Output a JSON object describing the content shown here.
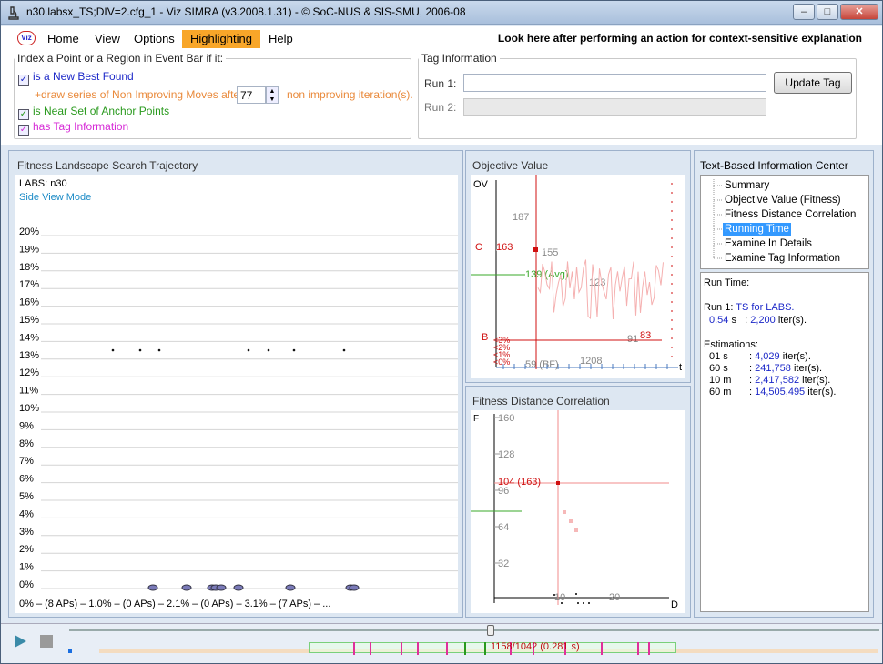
{
  "window": {
    "title": "n30.labsx_TS;DIV=2.cfg_1 - Viz SIMRA (v3.2008.1.31) - © SoC-NUS & SIS-SMU, 2006-08",
    "minimize": "–",
    "maximize": "□",
    "close": "✕"
  },
  "menu": {
    "logo": "Viz",
    "items": [
      "Home",
      "View",
      "Options",
      "Highlighting",
      "Help"
    ],
    "active": "Highlighting",
    "context_hint": "Look here after performing an action for context-sensitive explanation"
  },
  "index_group": {
    "legend": "Index a Point or a Region in Event Bar if it:",
    "opt1": "is a New Best Found",
    "opt1a_prefix": "+draw series of Non Improving Moves after:",
    "opt1a_value": "77",
    "opt1a_suffix": "non improving iteration(s).",
    "opt2": "is Near Set of Anchor Points",
    "opt3": "has Tag Information"
  },
  "tag_group": {
    "legend": "Tag Information",
    "run1_label": "Run 1:",
    "run2_label": "Run 2:",
    "run1_value": "",
    "run2_value": "",
    "update_button": "Update Tag"
  },
  "fitness_panel": {
    "title": "Fitness Landscape Search Trajectory",
    "instance": "LABS: n30",
    "mode": "Side View Mode",
    "y_ticks": [
      "20%",
      "19%",
      "18%",
      "17%",
      "16%",
      "15%",
      "14%",
      "13%",
      "12%",
      "11%",
      "10%",
      "9%",
      "8%",
      "7%",
      "6%",
      "5%",
      "4%",
      "3%",
      "2%",
      "1%",
      "0%"
    ],
    "footer": "0% – (8 APs) – 1.0% – (0 APs) – 2.1% – (0 APs) – 3.1% – (7 APs) – ..."
  },
  "objective_panel": {
    "title": "Objective Value",
    "axis_y": "OV",
    "axis_x": "t",
    "y_ticks": [
      "187",
      "155",
      "123",
      "91"
    ],
    "c_label": "C",
    "c_value": "163",
    "avg_label": "139 (Avg)",
    "b_label": "B",
    "b_value": "83",
    "pct_labels": [
      "<3%",
      "<2%",
      "<1%",
      "<0%"
    ],
    "x_ticks": [
      "59 (BF)",
      "1208"
    ]
  },
  "fdc_panel": {
    "title": "Fitness Distance Correlation",
    "axis_y": "F",
    "axis_x": "D",
    "y_ticks": [
      "160",
      "128",
      "96",
      "64",
      "32"
    ],
    "point_label": "104 (163)",
    "x_ticks": [
      "10",
      "20"
    ]
  },
  "info_panel": {
    "title": "Text-Based Information Center",
    "tree": [
      "Summary",
      "Objective Value (Fitness)",
      "Fitness Distance Correlation",
      "Running Time",
      "Examine In Details",
      "Examine Tag Information"
    ],
    "selected": "Running Time",
    "heading": "Run Time:",
    "run_prefix": "Run 1:",
    "run_algo": "TS for LABS.",
    "run_time": "0.54",
    "run_time_unit": "s",
    "run_iters": "2,200",
    "iter_unit": "iter(s).",
    "est_heading": "Estimations:",
    "estimates": [
      {
        "t": "01 s",
        "v": "4,029"
      },
      {
        "t": "60 s",
        "v": "241,758"
      },
      {
        "t": "10 m",
        "v": "2,417,582"
      },
      {
        "t": "60 m",
        "v": "14,505,495"
      }
    ]
  },
  "playback": {
    "play_icon": "play-icon",
    "stop_icon": "stop-icon",
    "position_label": "1158/1042 (0.281 s)"
  },
  "colors": {
    "highlight": "#f8a629",
    "ov_line": "#f5b0b0",
    "red": "#d01010",
    "avg": "#3aa82a",
    "selected": "#3399ff"
  }
}
